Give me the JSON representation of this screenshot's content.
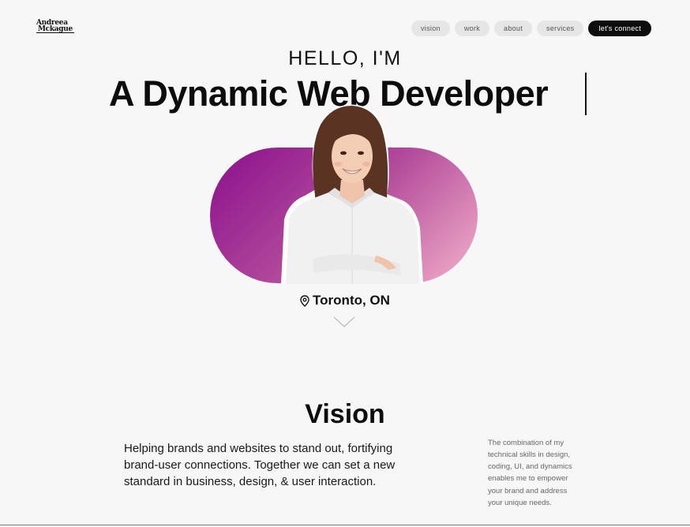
{
  "brand": {
    "line1": "Andreea",
    "line2": "Mckague"
  },
  "nav": {
    "items": [
      {
        "label": "vision"
      },
      {
        "label": "work"
      },
      {
        "label": "about"
      },
      {
        "label": "services"
      }
    ],
    "cta": "let's connect"
  },
  "hero": {
    "greeting": "HELLO, I'M",
    "headline": "A Dynamic Web Developer",
    "location": "Toronto, ON",
    "gradient": [
      "#8a0f8d",
      "#f3b1c9"
    ]
  },
  "icons": {
    "location": "map-pin-icon",
    "scroll": "chevron-down-icon"
  },
  "vision": {
    "title": "Vision",
    "lead": "Helping brands and websites to stand out, fortifying brand-user connections. Together we can set a new standard in business, design, & user interaction.",
    "side": "The combination of my technical skills in design, coding, UI, and dynamics enables me to empower your brand and address your unique needs."
  }
}
